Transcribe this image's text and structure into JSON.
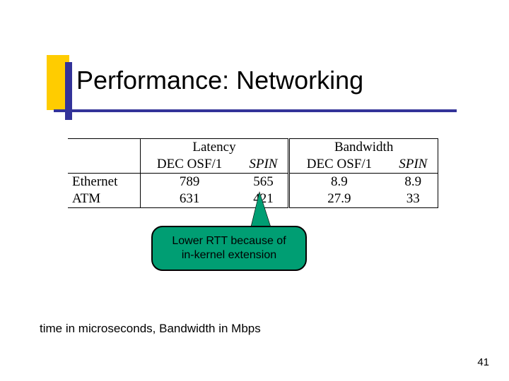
{
  "title": "Performance: Networking",
  "table": {
    "group_headers": {
      "latency": "Latency",
      "bandwidth": "Bandwidth"
    },
    "col_headers": {
      "lat_dec": "DEC OSF/1",
      "lat_spin": "SPIN",
      "bw_dec": "DEC OSF/1",
      "bw_spin": "SPIN"
    },
    "rows": [
      {
        "label": "Ethernet",
        "lat_dec": "789",
        "lat_spin": "565",
        "bw_dec": "8.9",
        "bw_spin": "8.9"
      },
      {
        "label": "ATM",
        "lat_dec": "631",
        "lat_spin": "421",
        "bw_dec": "27.9",
        "bw_spin": "33"
      }
    ]
  },
  "callout": {
    "line1": "Lower RTT because of",
    "line2": "in-kernel extension"
  },
  "footnote": "time in microseconds, Bandwidth in Mbps",
  "page_number": "41",
  "chart_data": {
    "type": "table",
    "title": "Performance: Networking",
    "columns": [
      "Latency DEC OSF/1",
      "Latency SPIN",
      "Bandwidth DEC OSF/1",
      "Bandwidth SPIN"
    ],
    "rows": [
      {
        "label": "Ethernet",
        "values": [
          789,
          565,
          8.9,
          8.9
        ]
      },
      {
        "label": "ATM",
        "values": [
          631,
          421,
          27.9,
          33
        ]
      }
    ],
    "units": {
      "Latency": "microseconds",
      "Bandwidth": "Mbps"
    }
  }
}
